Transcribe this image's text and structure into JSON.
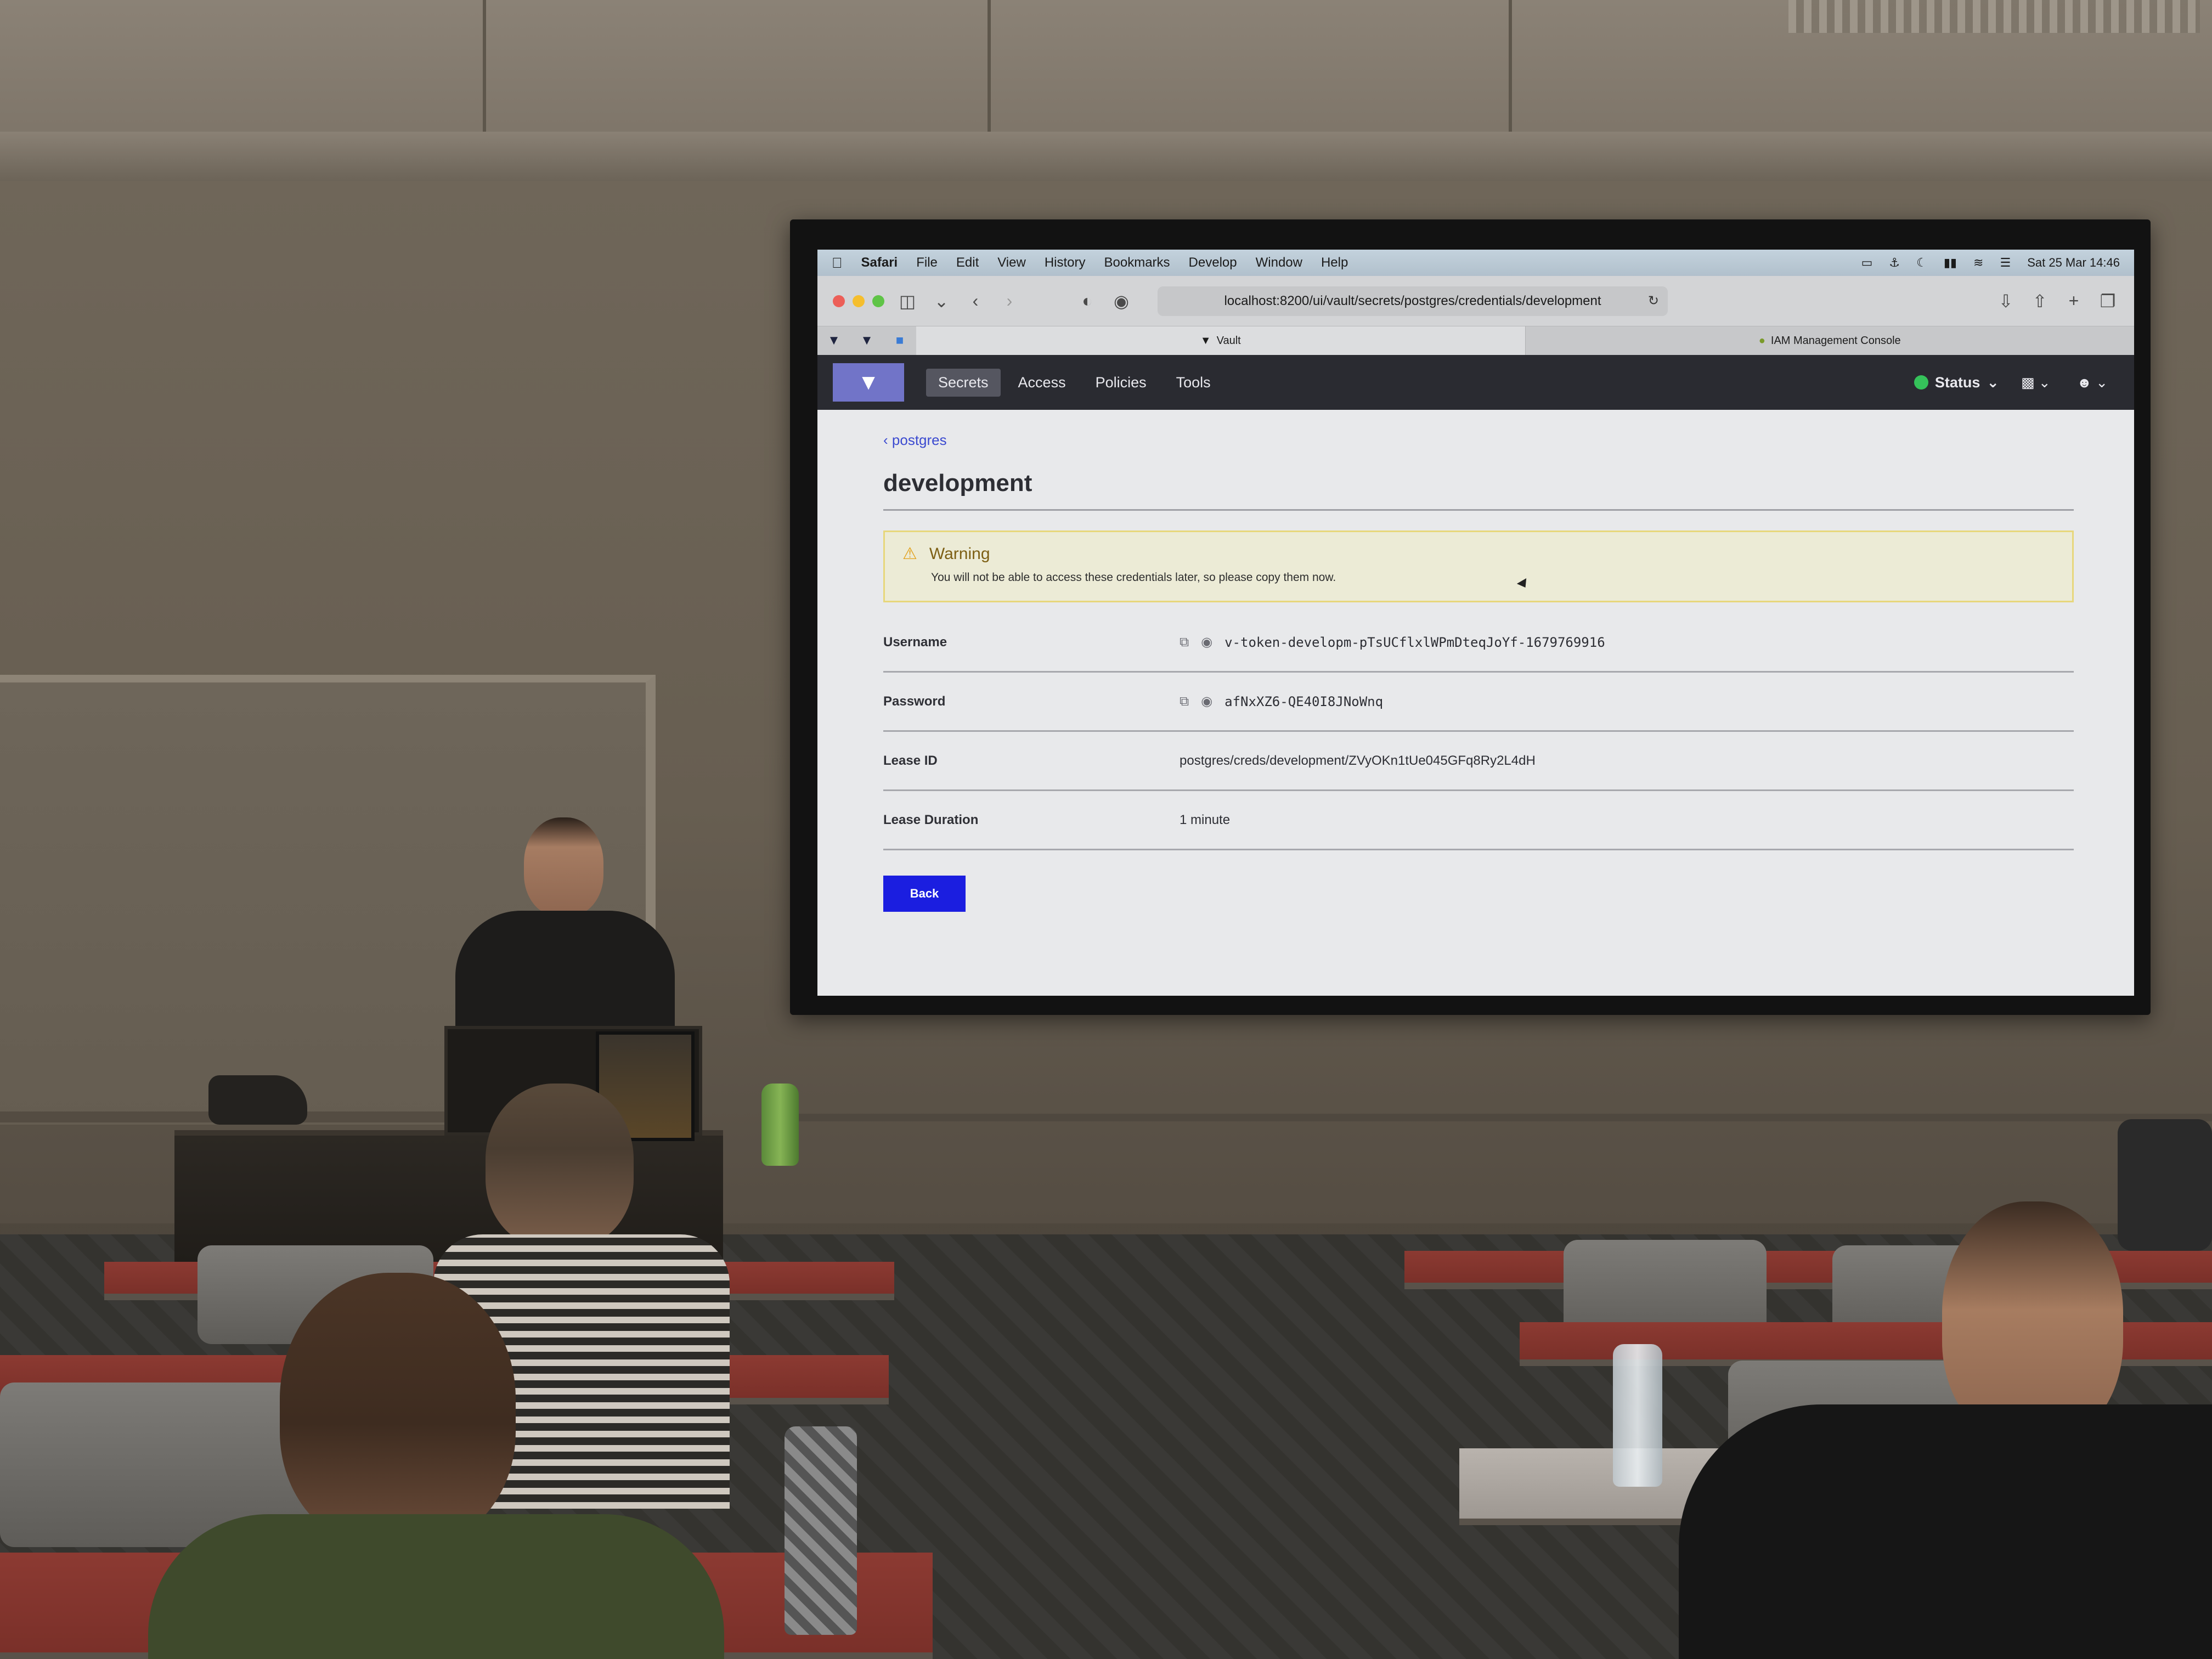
{
  "menubar": {
    "app": "Safari",
    "items": [
      "File",
      "Edit",
      "View",
      "History",
      "Bookmarks",
      "Develop",
      "Window",
      "Help"
    ],
    "clock": "Sat 25 Mar 14:46"
  },
  "browser": {
    "url": "localhost:8200/ui/vault/secrets/postgres/credentials/development",
    "tabs": [
      {
        "label": "Vault",
        "active": true
      },
      {
        "label": "IAM Management Console",
        "active": false
      }
    ]
  },
  "vault_nav": {
    "links": [
      "Secrets",
      "Access",
      "Policies",
      "Tools"
    ],
    "active": "Secrets",
    "status_label": "Status",
    "status_color": "#35c25a"
  },
  "content": {
    "breadcrumb": "postgres",
    "title": "development",
    "warning": {
      "title": "Warning",
      "text": "You will not be able to access these credentials later, so please copy them now."
    },
    "fields": [
      {
        "label": "Username",
        "value": "v-token-developm-pTsUCflxlWPmDteqJoYf-1679769916",
        "copyable": true
      },
      {
        "label": "Password",
        "value": "afNxXZ6-QE40I8JNoWnq",
        "copyable": true
      },
      {
        "label": "Lease ID",
        "value": "postgres/creds/development/ZVyOKn1tUe045GFq8Ry2L4dH",
        "copyable": false
      },
      {
        "label": "Lease Duration",
        "value": "1 minute",
        "copyable": false
      }
    ],
    "back_label": "Back",
    "accent_color": "#1b1ee0"
  }
}
